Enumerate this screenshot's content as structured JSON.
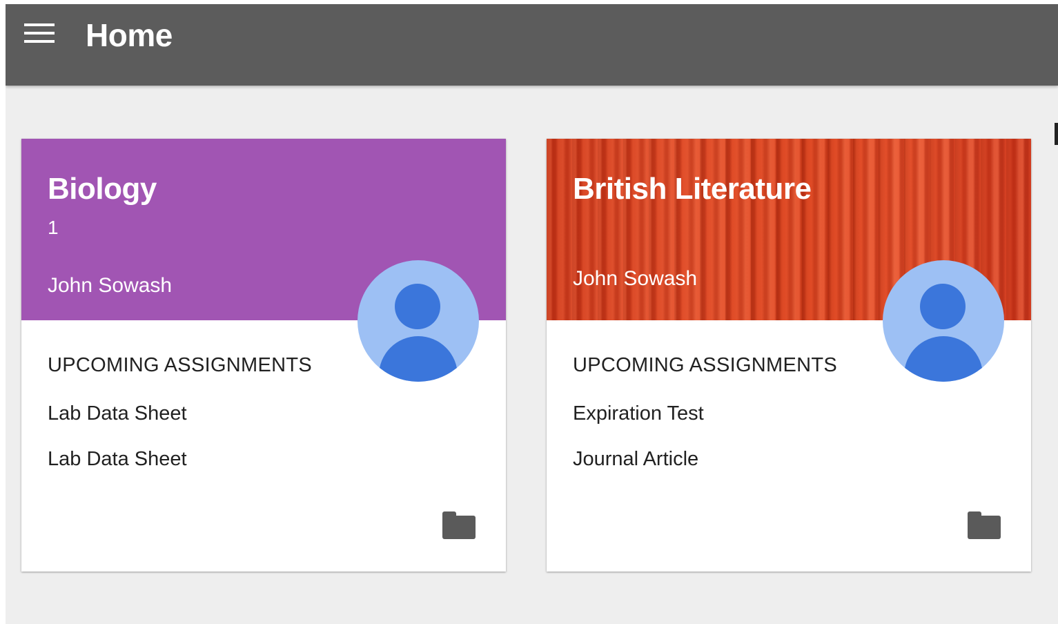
{
  "appbar": {
    "title": "Home",
    "menu_icon": "menu-icon",
    "background": "#5c5c5c"
  },
  "classes": [
    {
      "title": "Biology",
      "section": "1",
      "teacher": "John Sowash",
      "header_color": "#a155b3",
      "assignments_heading": "UPCOMING ASSIGNMENTS",
      "assignments": [
        "Lab Data Sheet",
        "Lab Data Sheet"
      ],
      "avatar_icon": "person-avatar-icon",
      "folder_icon": "folder-icon"
    },
    {
      "title": "British Literature",
      "section": "",
      "teacher": "John Sowash",
      "header_color": "#d8431f",
      "assignments_heading": "UPCOMING ASSIGNMENTS",
      "assignments": [
        "Expiration Test",
        "Journal Article"
      ],
      "avatar_icon": "person-avatar-icon",
      "folder_icon": "folder-icon"
    }
  ],
  "colors": {
    "page_background": "#eeeeee",
    "avatar_background": "#9dc0f4",
    "avatar_figure": "#3b76db",
    "folder": "#5a5a5a"
  }
}
